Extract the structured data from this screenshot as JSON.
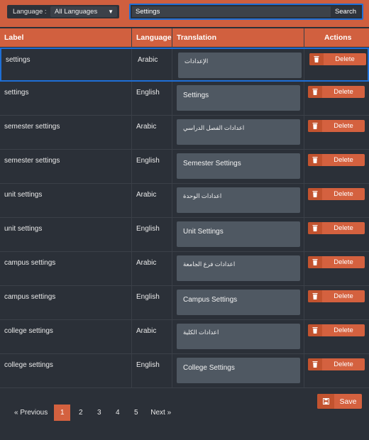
{
  "filter": {
    "language_label": "Language :",
    "language_value": "All Languages"
  },
  "search": {
    "value": "Settings",
    "button_label": "Search"
  },
  "table": {
    "headers": [
      "Label",
      "Language",
      "Translation",
      "Actions"
    ],
    "delete_label": "Delete",
    "rows": [
      {
        "label": "settings",
        "language": "Arabic",
        "translation": "الإعدادات",
        "selected": true
      },
      {
        "label": "settings",
        "language": "English",
        "translation": "Settings"
      },
      {
        "label": "semester settings",
        "language": "Arabic",
        "translation": "اعدادات الفصل الدراسي"
      },
      {
        "label": "semester settings",
        "language": "English",
        "translation": "Semester Settings"
      },
      {
        "label": "unit settings",
        "language": "Arabic",
        "translation": "اعدادات الوحدة"
      },
      {
        "label": "unit settings",
        "language": "English",
        "translation": "Unit Settings"
      },
      {
        "label": "campus settings",
        "language": "Arabic",
        "translation": "اعدادات فرع الجامعة"
      },
      {
        "label": "campus settings",
        "language": "English",
        "translation": "Campus Settings"
      },
      {
        "label": "college settings",
        "language": "Arabic",
        "translation": "اعدادات الكلية"
      },
      {
        "label": "college settings",
        "language": "English",
        "translation": "College Settings"
      }
    ]
  },
  "save_label": "Save",
  "pagination": {
    "prev": "« Previous",
    "pages": [
      "1",
      "2",
      "3",
      "4",
      "5"
    ],
    "current": "1",
    "next": "Next »"
  },
  "colors": {
    "accent": "#d4613f",
    "background": "#2b3038",
    "selection": "#1e6fd6"
  },
  "icons": {
    "delete": "trash-icon",
    "save": "floppy-disk-icon",
    "dropdown": "caret-down-icon"
  }
}
